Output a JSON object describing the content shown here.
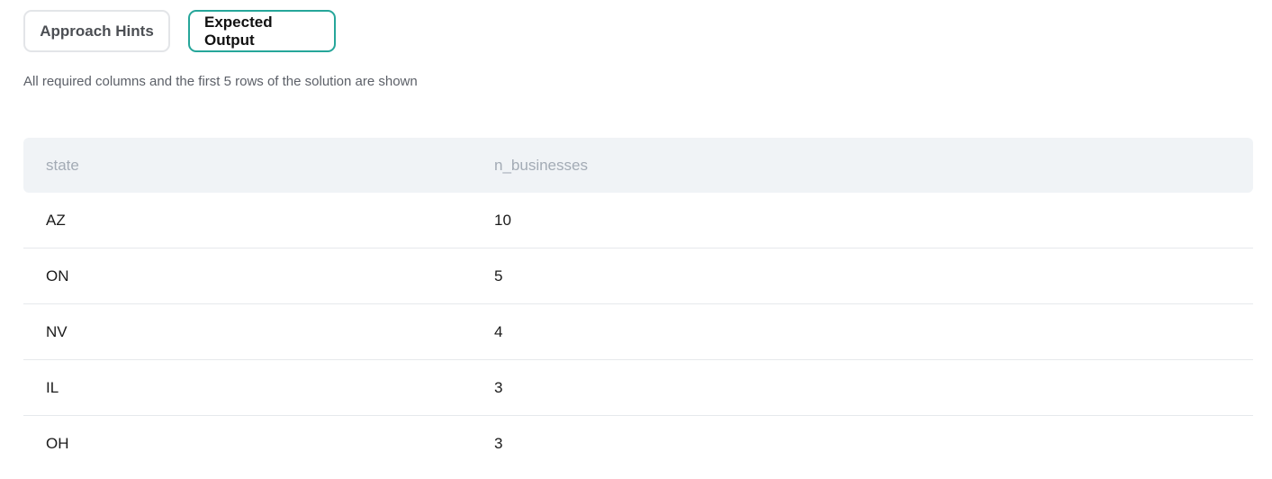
{
  "tabs": [
    {
      "label": "Approach Hints",
      "active": false
    },
    {
      "label": "Expected Output",
      "active": true
    }
  ],
  "subtitle": "All required columns and the first 5 rows of the solution are shown",
  "table": {
    "columns": [
      "state",
      "n_businesses"
    ],
    "rows": [
      [
        "AZ",
        "10"
      ],
      [
        "ON",
        "5"
      ],
      [
        "NV",
        "4"
      ],
      [
        "IL",
        "3"
      ],
      [
        "OH",
        "3"
      ]
    ]
  },
  "colors": {
    "accent": "#26a69a",
    "header_bg": "#f0f3f6"
  }
}
